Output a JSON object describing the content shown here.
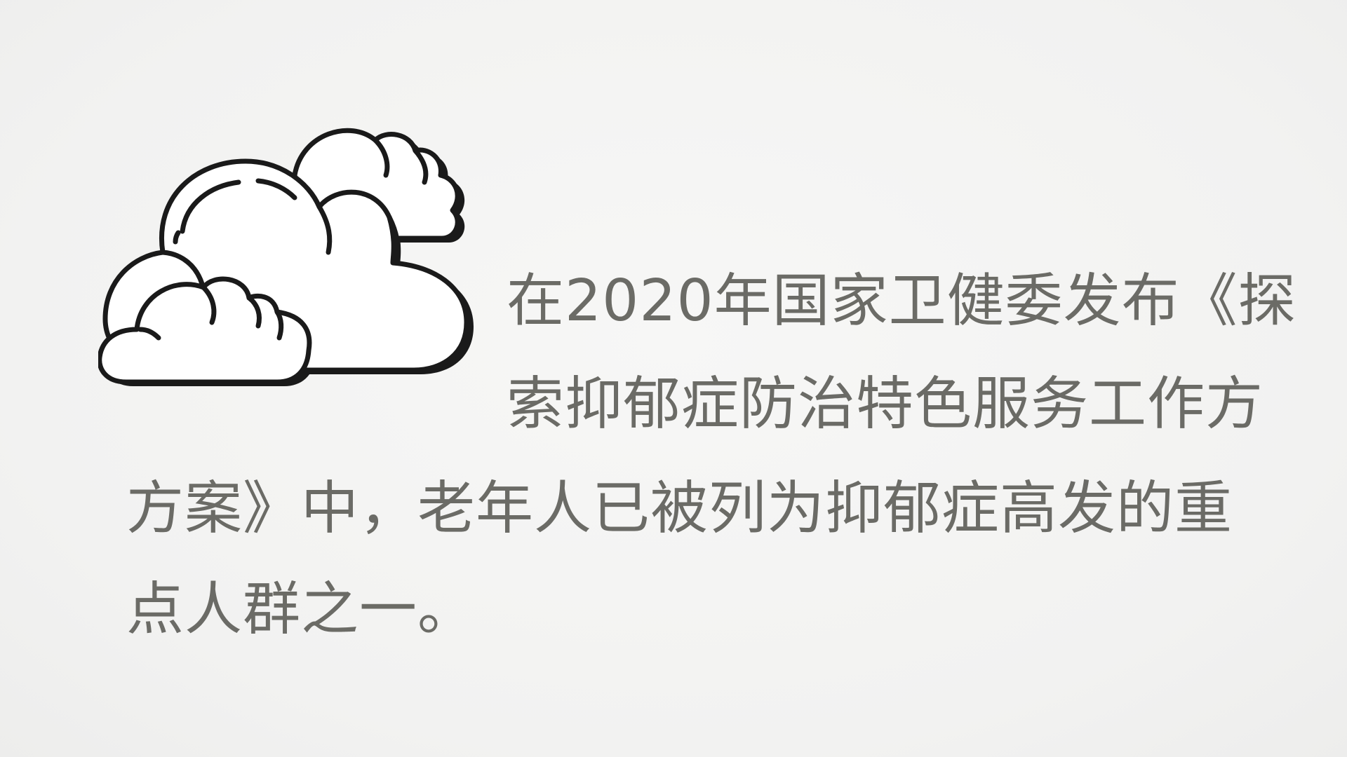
{
  "illustration": {
    "icon": "cloud-icon",
    "stroke_color": "#1a1a1a",
    "fill_color": "#ffffff"
  },
  "paragraph": {
    "text_color": "#6b6b66",
    "lines": [
      "在2020年国家卫健委发布《探",
      "索抑郁症防治特色服务工作方",
      "方案》中，老年人已被列为抑郁症高发的重",
      "点人群之一。"
    ]
  }
}
